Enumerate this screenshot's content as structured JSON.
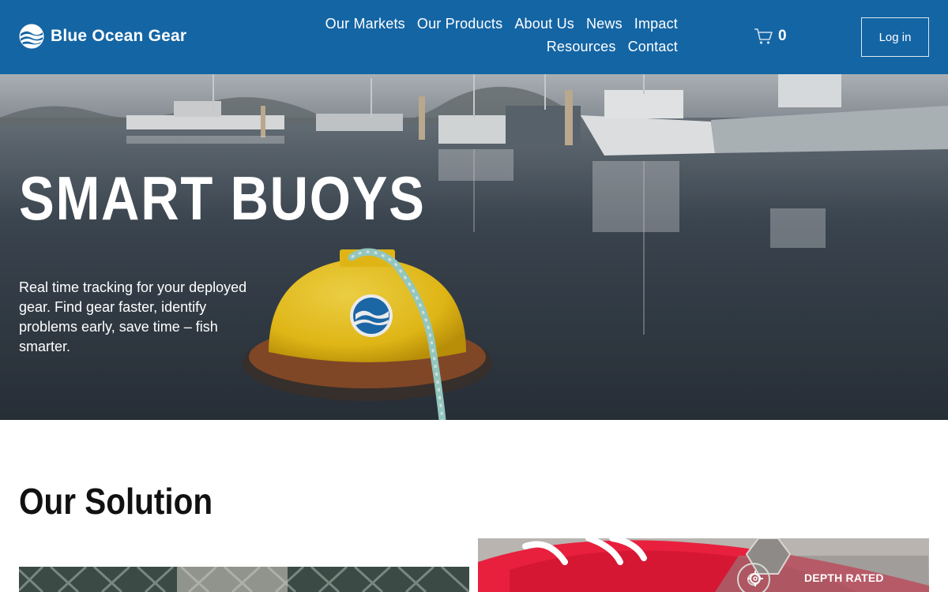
{
  "header": {
    "brand_name": "Blue Ocean Gear",
    "nav": [
      "Our Markets",
      "Our Products",
      "About Us",
      "News",
      "Impact",
      "Resources",
      "Contact"
    ],
    "cart_count": "0",
    "login_label": "Log in",
    "icons": {
      "logo": "wave-logo-icon",
      "cart": "cart-icon"
    }
  },
  "hero": {
    "title": "SMART BUOYS",
    "description": "Real time tracking for your deployed gear. Find gear faster, identify problems early, save time – fish smarter."
  },
  "solution": {
    "title": "Our Solution",
    "badge_label": "DEPTH RATED",
    "icons": {
      "badge": "gear-icon"
    }
  },
  "colors": {
    "brand_blue": "#1465a4",
    "buoy_yellow": "#f2c518",
    "bucket_red": "#e8203e"
  }
}
